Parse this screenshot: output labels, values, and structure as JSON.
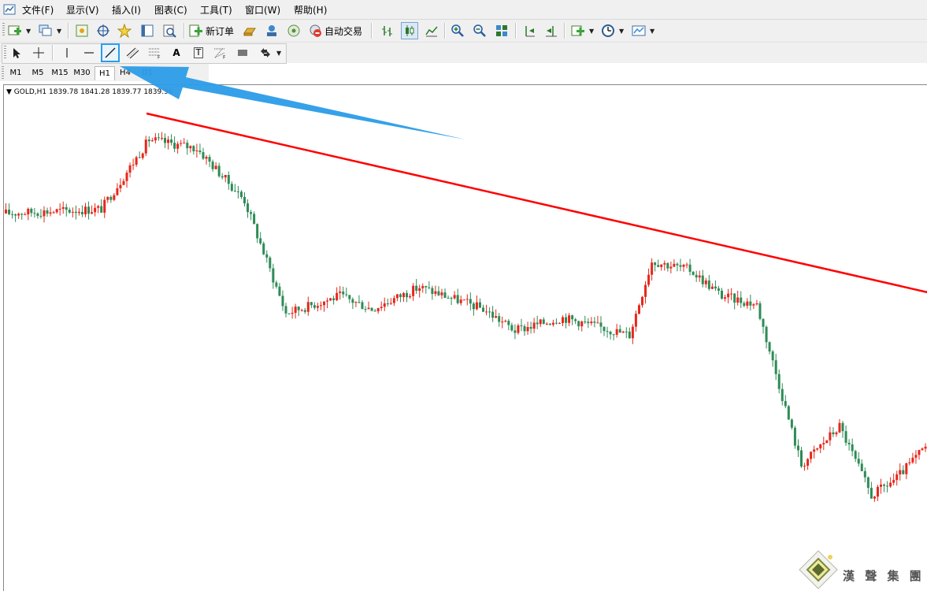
{
  "menu": [
    "文件(F)",
    "显示(V)",
    "插入(I)",
    "图表(C)",
    "工具(T)",
    "窗口(W)",
    "帮助(H)"
  ],
  "toolbar": {
    "new_order_label": "新订单",
    "auto_trade_label": "自动交易"
  },
  "drawing_tools": {
    "text_tool_label": "A",
    "text_label_tool_label": "T"
  },
  "timeframes": [
    "M1",
    "M5",
    "M15",
    "M30",
    "H1",
    "H4",
    "D1"
  ],
  "active_timeframe": "H1",
  "chart_header": {
    "symbol": "GOLD,H1",
    "open": "1839.78",
    "high": "1841.28",
    "low": "1839.77",
    "close": "1839.96"
  },
  "colors": {
    "bull": "#e8261b",
    "bear": "#2e8b57",
    "trendline": "#ff0000",
    "arrow": "#2b9ce8"
  },
  "chart_data": {
    "type": "candlestick",
    "symbol": "GOLD",
    "timeframe": "H1",
    "trendline": "descending line drawn across the highs",
    "anchors": [
      {
        "bar": 0,
        "price": 1839
      },
      {
        "bar": 30,
        "price": 1840
      },
      {
        "bar": 45,
        "price": 1856
      },
      {
        "bar": 60,
        "price": 1854
      },
      {
        "bar": 75,
        "price": 1842
      },
      {
        "bar": 88,
        "price": 1816
      },
      {
        "bar": 105,
        "price": 1820
      },
      {
        "bar": 115,
        "price": 1817
      },
      {
        "bar": 130,
        "price": 1822
      },
      {
        "bar": 150,
        "price": 1817
      },
      {
        "bar": 160,
        "price": 1812
      },
      {
        "bar": 175,
        "price": 1815
      },
      {
        "bar": 196,
        "price": 1811
      },
      {
        "bar": 203,
        "price": 1828
      },
      {
        "bar": 215,
        "price": 1826
      },
      {
        "bar": 225,
        "price": 1820
      },
      {
        "bar": 236,
        "price": 1818
      },
      {
        "bar": 250,
        "price": 1781
      },
      {
        "bar": 262,
        "price": 1790
      },
      {
        "bar": 272,
        "price": 1774
      },
      {
        "bar": 280,
        "price": 1778
      },
      {
        "bar": 290,
        "price": 1786
      }
    ]
  },
  "watermark": {
    "text": "漢 聲 集 團"
  }
}
